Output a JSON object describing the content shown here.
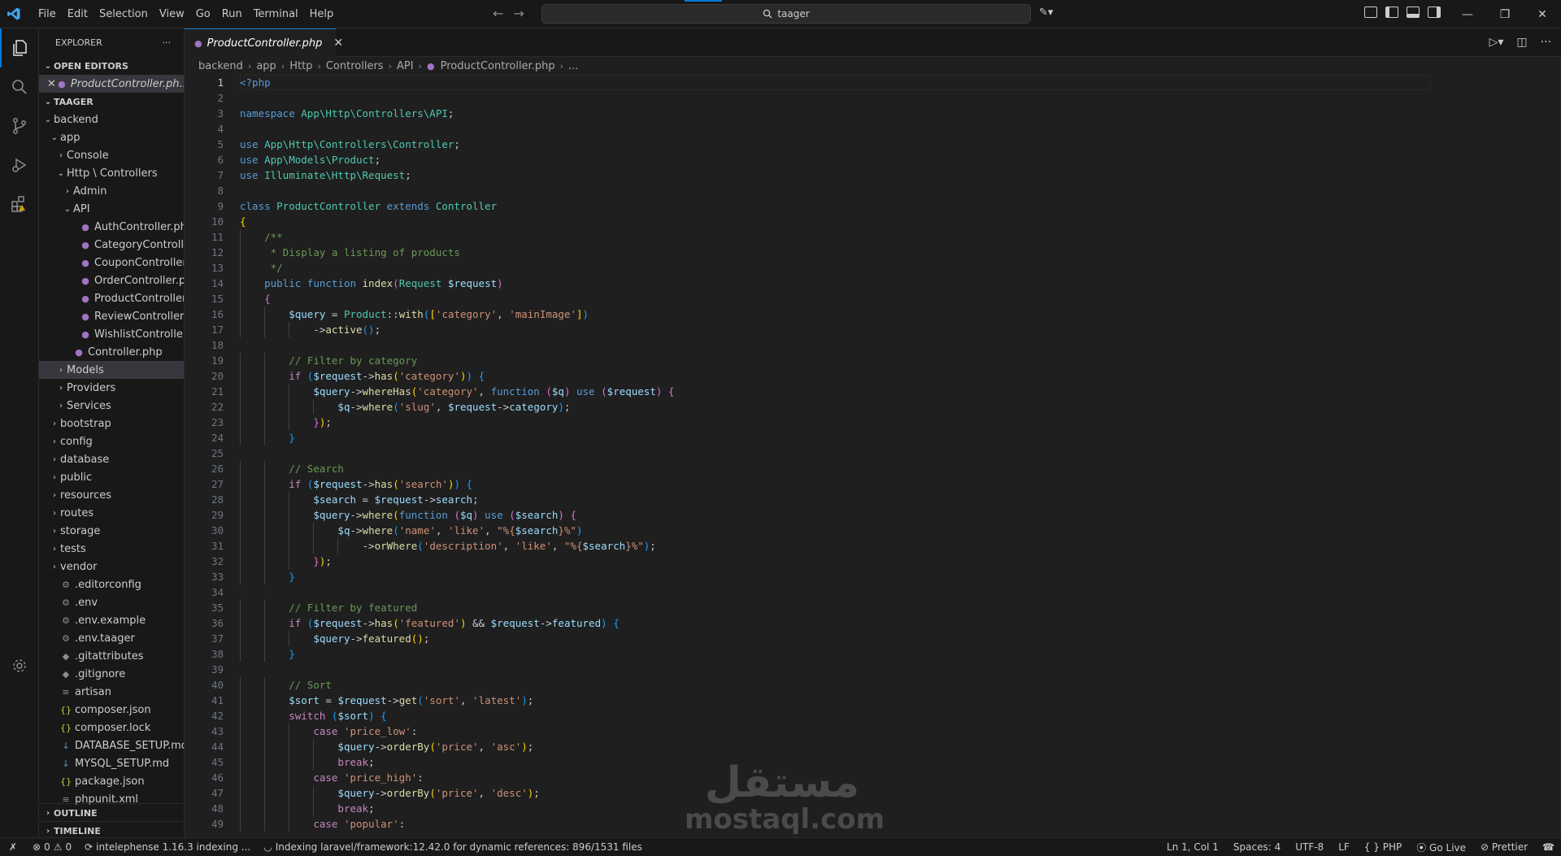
{
  "window": {
    "menu": [
      "File",
      "Edit",
      "Selection",
      "View",
      "Go",
      "Run",
      "Terminal",
      "Help"
    ],
    "search_text": "taager"
  },
  "sidebar": {
    "title": "EXPLORER",
    "open_editors_label": "OPEN EDITORS",
    "open_editor_file": "ProductController.ph...",
    "project_label": "TAAGER",
    "tree": [
      {
        "label": "backend",
        "kind": "folder-open",
        "depth": 0
      },
      {
        "label": "app",
        "kind": "folder-open",
        "depth": 1
      },
      {
        "label": "Console",
        "kind": "folder",
        "depth": 2
      },
      {
        "label": "Http \\ Controllers",
        "kind": "folder-open",
        "depth": 2
      },
      {
        "label": "Admin",
        "kind": "folder",
        "depth": 3
      },
      {
        "label": "API",
        "kind": "folder-open",
        "depth": 3
      },
      {
        "label": "AuthController.php",
        "kind": "php",
        "depth": 4
      },
      {
        "label": "CategoryControlle...",
        "kind": "php",
        "depth": 4
      },
      {
        "label": "CouponController....",
        "kind": "php",
        "depth": 4
      },
      {
        "label": "OrderController.php",
        "kind": "php",
        "depth": 4
      },
      {
        "label": "ProductController....",
        "kind": "php",
        "depth": 4
      },
      {
        "label": "ReviewController.p...",
        "kind": "php",
        "depth": 4
      },
      {
        "label": "WishlistController....",
        "kind": "php",
        "depth": 4
      },
      {
        "label": "Controller.php",
        "kind": "php",
        "depth": 3
      },
      {
        "label": "Models",
        "kind": "folder",
        "depth": 2,
        "selected": true
      },
      {
        "label": "Providers",
        "kind": "folder",
        "depth": 2
      },
      {
        "label": "Services",
        "kind": "folder",
        "depth": 2
      },
      {
        "label": "bootstrap",
        "kind": "folder",
        "depth": 1
      },
      {
        "label": "config",
        "kind": "folder",
        "depth": 1
      },
      {
        "label": "database",
        "kind": "folder",
        "depth": 1
      },
      {
        "label": "public",
        "kind": "folder",
        "depth": 1
      },
      {
        "label": "resources",
        "kind": "folder",
        "depth": 1
      },
      {
        "label": "routes",
        "kind": "folder",
        "depth": 1
      },
      {
        "label": "storage",
        "kind": "folder",
        "depth": 1
      },
      {
        "label": "tests",
        "kind": "folder",
        "depth": 1
      },
      {
        "label": "vendor",
        "kind": "folder",
        "depth": 1
      },
      {
        "label": ".editorconfig",
        "kind": "config",
        "depth": 1
      },
      {
        "label": ".env",
        "kind": "config",
        "depth": 1
      },
      {
        "label": ".env.example",
        "kind": "config",
        "depth": 1
      },
      {
        "label": ".env.taager",
        "kind": "config",
        "depth": 1
      },
      {
        "label": ".gitattributes",
        "kind": "git",
        "depth": 1
      },
      {
        "label": ".gitignore",
        "kind": "git",
        "depth": 1
      },
      {
        "label": "artisan",
        "kind": "lines",
        "depth": 1
      },
      {
        "label": "composer.json",
        "kind": "json",
        "depth": 1
      },
      {
        "label": "composer.lock",
        "kind": "json",
        "depth": 1
      },
      {
        "label": "DATABASE_SETUP.md",
        "kind": "md",
        "depth": 1
      },
      {
        "label": "MYSQL_SETUP.md",
        "kind": "md",
        "depth": 1
      },
      {
        "label": "package.json",
        "kind": "json",
        "depth": 1
      },
      {
        "label": "phpunit.xml",
        "kind": "lines",
        "depth": 1
      }
    ],
    "outline_label": "OUTLINE",
    "timeline_label": "TIMELINE"
  },
  "editor": {
    "tab_label": "ProductController.php",
    "breadcrumb": [
      "backend",
      "app",
      "Http",
      "Controllers",
      "API",
      "ProductController.php",
      "..."
    ],
    "current_line": 1,
    "code_lines": [
      [
        [
          "<?php",
          "k"
        ]
      ],
      [],
      [
        [
          "namespace ",
          "k"
        ],
        [
          "App\\Http\\Controllers\\API",
          "cls"
        ],
        [
          ";",
          ""
        ]
      ],
      [],
      [
        [
          "use ",
          "k"
        ],
        [
          "App\\Http\\Controllers\\",
          "cls"
        ],
        [
          "Controller",
          "cls"
        ],
        [
          ";",
          ""
        ]
      ],
      [
        [
          "use ",
          "k"
        ],
        [
          "App\\Models\\",
          "cls"
        ],
        [
          "Product",
          "cls"
        ],
        [
          ";",
          ""
        ]
      ],
      [
        [
          "use ",
          "k"
        ],
        [
          "Illuminate\\Http\\",
          "cls"
        ],
        [
          "Request",
          "cls"
        ],
        [
          ";",
          ""
        ]
      ],
      [],
      [
        [
          "class ",
          "k"
        ],
        [
          "ProductController ",
          "cls"
        ],
        [
          "extends ",
          "k"
        ],
        [
          "Controller",
          "cls"
        ]
      ],
      [
        [
          "{",
          "b1"
        ]
      ],
      [
        [
          "    "
        ],
        [
          "/**",
          "c"
        ]
      ],
      [
        [
          "    "
        ],
        [
          " * Display a listing of products",
          "c"
        ]
      ],
      [
        [
          "    "
        ],
        [
          " */",
          "c"
        ]
      ],
      [
        [
          "    "
        ],
        [
          "public ",
          "k"
        ],
        [
          "function ",
          "k"
        ],
        [
          "index",
          "fn"
        ],
        [
          "(",
          "b2"
        ],
        [
          "Request ",
          "cls"
        ],
        [
          "$request",
          "v"
        ],
        [
          ")",
          "b2"
        ]
      ],
      [
        [
          "    "
        ],
        [
          "{",
          "b2"
        ]
      ],
      [
        [
          "        "
        ],
        [
          "$query ",
          "v"
        ],
        [
          "= ",
          ""
        ],
        [
          "Product",
          "cls"
        ],
        [
          "::",
          ""
        ],
        [
          "with",
          "fn"
        ],
        [
          "(",
          "b3"
        ],
        [
          "[",
          "b1"
        ],
        [
          "'category'",
          "s"
        ],
        [
          ", ",
          ""
        ],
        [
          "'mainImage'",
          "s"
        ],
        [
          "]",
          "b1"
        ],
        [
          ")",
          "b3"
        ]
      ],
      [
        [
          "            ->"
        ],
        [
          "active",
          "fn"
        ],
        [
          "(",
          "b3"
        ],
        [
          ")",
          "b3"
        ],
        [
          ";",
          ""
        ]
      ],
      [],
      [
        [
          "        "
        ],
        [
          "// Filter by category",
          "c"
        ]
      ],
      [
        [
          "        "
        ],
        [
          "if ",
          "cf"
        ],
        [
          "(",
          "b3"
        ],
        [
          "$request",
          "v"
        ],
        [
          "->",
          ""
        ],
        [
          "has",
          "fn"
        ],
        [
          "(",
          "b1"
        ],
        [
          "'category'",
          "s"
        ],
        [
          ")",
          "b1"
        ],
        [
          ") ",
          "b3"
        ],
        [
          "{",
          "b3"
        ]
      ],
      [
        [
          "            "
        ],
        [
          "$query",
          "v"
        ],
        [
          "->",
          ""
        ],
        [
          "whereHas",
          "fn"
        ],
        [
          "(",
          "b1"
        ],
        [
          "'category'",
          "s"
        ],
        [
          ", ",
          ""
        ],
        [
          "function ",
          "k"
        ],
        [
          "(",
          "b2"
        ],
        [
          "$q",
          "v"
        ],
        [
          ") ",
          "b2"
        ],
        [
          "use ",
          "k"
        ],
        [
          "(",
          "b2"
        ],
        [
          "$request",
          "v"
        ],
        [
          ") ",
          "b2"
        ],
        [
          "{",
          "b2"
        ]
      ],
      [
        [
          "                "
        ],
        [
          "$q",
          "v"
        ],
        [
          "->",
          ""
        ],
        [
          "where",
          "fn"
        ],
        [
          "(",
          "b3"
        ],
        [
          "'slug'",
          "s"
        ],
        [
          ", ",
          ""
        ],
        [
          "$request",
          "v"
        ],
        [
          "->",
          ""
        ],
        [
          "category",
          "v"
        ],
        [
          ")",
          "b3"
        ],
        [
          ";",
          ""
        ]
      ],
      [
        [
          "            "
        ],
        [
          "}",
          "b2"
        ],
        [
          ")",
          "b1"
        ],
        [
          ";",
          ""
        ]
      ],
      [
        [
          "        "
        ],
        [
          "}",
          "b3"
        ]
      ],
      [],
      [
        [
          "        "
        ],
        [
          "// Search",
          "c"
        ]
      ],
      [
        [
          "        "
        ],
        [
          "if ",
          "cf"
        ],
        [
          "(",
          "b3"
        ],
        [
          "$request",
          "v"
        ],
        [
          "->",
          ""
        ],
        [
          "has",
          "fn"
        ],
        [
          "(",
          "b1"
        ],
        [
          "'search'",
          "s"
        ],
        [
          ")",
          "b1"
        ],
        [
          ") ",
          "b3"
        ],
        [
          "{",
          "b3"
        ]
      ],
      [
        [
          "            "
        ],
        [
          "$search ",
          "v"
        ],
        [
          "= ",
          ""
        ],
        [
          "$request",
          "v"
        ],
        [
          "->",
          ""
        ],
        [
          "search",
          "v"
        ],
        [
          ";",
          ""
        ]
      ],
      [
        [
          "            "
        ],
        [
          "$query",
          "v"
        ],
        [
          "->",
          ""
        ],
        [
          "where",
          "fn"
        ],
        [
          "(",
          "b1"
        ],
        [
          "function ",
          "k"
        ],
        [
          "(",
          "b2"
        ],
        [
          "$q",
          "v"
        ],
        [
          ") ",
          "b2"
        ],
        [
          "use ",
          "k"
        ],
        [
          "(",
          "b2"
        ],
        [
          "$search",
          "v"
        ],
        [
          ") ",
          "b2"
        ],
        [
          "{",
          "b2"
        ]
      ],
      [
        [
          "                "
        ],
        [
          "$q",
          "v"
        ],
        [
          "->",
          ""
        ],
        [
          "where",
          "fn"
        ],
        [
          "(",
          "b3"
        ],
        [
          "'name'",
          "s"
        ],
        [
          ", ",
          ""
        ],
        [
          "'like'",
          "s"
        ],
        [
          ", ",
          ""
        ],
        [
          "\"%{",
          "s"
        ],
        [
          "$search",
          "v"
        ],
        [
          "}%\"",
          "s"
        ],
        [
          ")",
          "b3"
        ]
      ],
      [
        [
          "                    ->"
        ],
        [
          "orWhere",
          "fn"
        ],
        [
          "(",
          "b3"
        ],
        [
          "'description'",
          "s"
        ],
        [
          ", ",
          ""
        ],
        [
          "'like'",
          "s"
        ],
        [
          ", ",
          ""
        ],
        [
          "\"%{",
          "s"
        ],
        [
          "$search",
          "v"
        ],
        [
          "}%\"",
          "s"
        ],
        [
          ")",
          "b3"
        ],
        [
          ";",
          ""
        ]
      ],
      [
        [
          "            "
        ],
        [
          "}",
          "b2"
        ],
        [
          ")",
          "b1"
        ],
        [
          ";",
          ""
        ]
      ],
      [
        [
          "        "
        ],
        [
          "}",
          "b3"
        ]
      ],
      [],
      [
        [
          "        "
        ],
        [
          "// Filter by featured",
          "c"
        ]
      ],
      [
        [
          "        "
        ],
        [
          "if ",
          "cf"
        ],
        [
          "(",
          "b3"
        ],
        [
          "$request",
          "v"
        ],
        [
          "->",
          ""
        ],
        [
          "has",
          "fn"
        ],
        [
          "(",
          "b1"
        ],
        [
          "'featured'",
          "s"
        ],
        [
          ") ",
          "b1"
        ],
        [
          "&& ",
          ""
        ],
        [
          "$request",
          "v"
        ],
        [
          "->",
          ""
        ],
        [
          "featured",
          "v"
        ],
        [
          ") ",
          "b3"
        ],
        [
          "{",
          "b3"
        ]
      ],
      [
        [
          "            "
        ],
        [
          "$query",
          "v"
        ],
        [
          "->",
          ""
        ],
        [
          "featured",
          "fn"
        ],
        [
          "(",
          "b1"
        ],
        [
          ")",
          "b1"
        ],
        [
          ";",
          ""
        ]
      ],
      [
        [
          "        "
        ],
        [
          "}",
          "b3"
        ]
      ],
      [],
      [
        [
          "        "
        ],
        [
          "// Sort",
          "c"
        ]
      ],
      [
        [
          "        "
        ],
        [
          "$sort ",
          "v"
        ],
        [
          "= ",
          ""
        ],
        [
          "$request",
          "v"
        ],
        [
          "->",
          ""
        ],
        [
          "get",
          "fn"
        ],
        [
          "(",
          "b3"
        ],
        [
          "'sort'",
          "s"
        ],
        [
          ", ",
          ""
        ],
        [
          "'latest'",
          "s"
        ],
        [
          ")",
          "b3"
        ],
        [
          ";",
          ""
        ]
      ],
      [
        [
          "        "
        ],
        [
          "switch ",
          "cf"
        ],
        [
          "(",
          "b3"
        ],
        [
          "$sort",
          "v"
        ],
        [
          ") ",
          "b3"
        ],
        [
          "{",
          "b3"
        ]
      ],
      [
        [
          "            "
        ],
        [
          "case ",
          "cf"
        ],
        [
          "'price_low'",
          "s"
        ],
        [
          ":",
          ""
        ]
      ],
      [
        [
          "                "
        ],
        [
          "$query",
          "v"
        ],
        [
          "->",
          ""
        ],
        [
          "orderBy",
          "fn"
        ],
        [
          "(",
          "b1"
        ],
        [
          "'price'",
          "s"
        ],
        [
          ", ",
          ""
        ],
        [
          "'asc'",
          "s"
        ],
        [
          ")",
          "b1"
        ],
        [
          ";",
          ""
        ]
      ],
      [
        [
          "                "
        ],
        [
          "break",
          "cf"
        ],
        [
          ";",
          ""
        ]
      ],
      [
        [
          "            "
        ],
        [
          "case ",
          "cf"
        ],
        [
          "'price_high'",
          "s"
        ],
        [
          ":",
          ""
        ]
      ],
      [
        [
          "                "
        ],
        [
          "$query",
          "v"
        ],
        [
          "->",
          ""
        ],
        [
          "orderBy",
          "fn"
        ],
        [
          "(",
          "b1"
        ],
        [
          "'price'",
          "s"
        ],
        [
          ", ",
          ""
        ],
        [
          "'desc'",
          "s"
        ],
        [
          ")",
          "b1"
        ],
        [
          ";",
          ""
        ]
      ],
      [
        [
          "                "
        ],
        [
          "break",
          "cf"
        ],
        [
          ";",
          ""
        ]
      ],
      [
        [
          "            "
        ],
        [
          "case ",
          "cf"
        ],
        [
          "'popular'",
          "s"
        ],
        [
          ":",
          ""
        ]
      ]
    ]
  },
  "watermark": {
    "arabic": "مستقل",
    "latin": "mostaql.com"
  },
  "statusbar": {
    "errors": "0",
    "warnings": "0",
    "intelephense": "intelephense 1.16.3 indexing ...",
    "indexing": "Indexing laravel/framework:12.42.0 for dynamic references: 896/1531 files",
    "position": "Ln 1, Col 1",
    "spaces": "Spaces: 4",
    "encoding": "UTF-8",
    "eol": "LF",
    "language": "PHP",
    "golive": "Go Live",
    "prettier": "Prettier"
  },
  "colors": {
    "accent": "#0078d4",
    "background": "#1f1f1f",
    "chrome": "#181818"
  }
}
